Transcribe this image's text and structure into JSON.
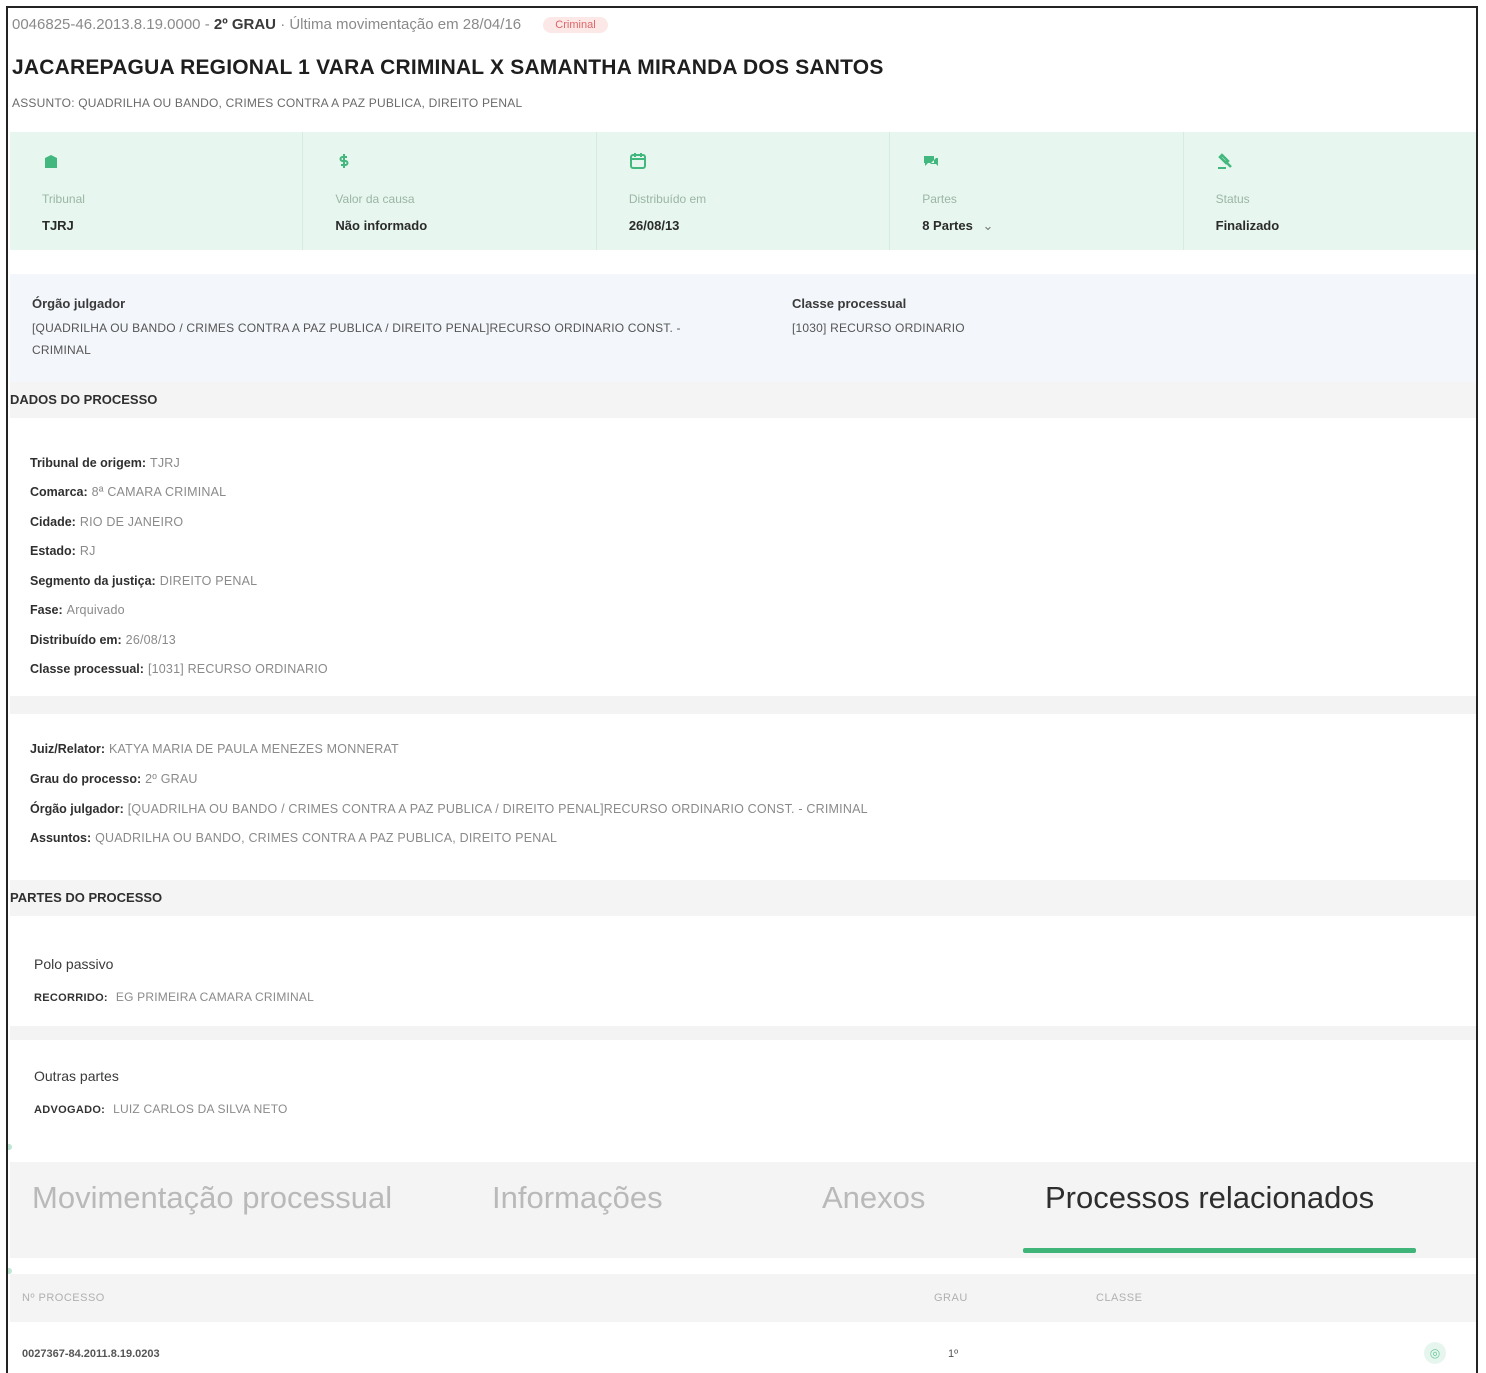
{
  "header": {
    "process_number": "0046825-46.2013.8.19.0000",
    "grau": "2º GRAU",
    "last_movement": "· Última movimentação em 28/04/16",
    "badge": "Criminal",
    "title": "JACAREPAGUA REGIONAL 1 VARA CRIMINAL X SAMANTHA MIRANDA DOS SANTOS",
    "subject": "ASSUNTO: QUADRILHA OU BANDO, CRIMES CONTRA A PAZ PUBLICA, DIREITO PENAL"
  },
  "summary": [
    {
      "icon": "building-icon",
      "label": "Tribunal",
      "value": "TJRJ"
    },
    {
      "icon": "money-icon",
      "label": "Valor da causa",
      "value": "Não informado"
    },
    {
      "icon": "calendar-icon",
      "label": "Distribuído em",
      "value": "26/08/13"
    },
    {
      "icon": "chat-icon",
      "label": "Partes",
      "value": "8 Partes"
    },
    {
      "icon": "gavel-icon",
      "label": "Status",
      "value": "Finalizado"
    }
  ],
  "organ": {
    "orgao_label": "Órgão julgador",
    "orgao_value": "[QUADRILHA OU BANDO / CRIMES CONTRA A PAZ PUBLICA / DIREITO PENAL]RECURSO ORDINARIO CONST. - CRIMINAL",
    "classe_label": "Classe processual",
    "classe_value": "[1030] RECURSO ORDINARIO"
  },
  "dados": {
    "title": "DADOS DO PROCESSO",
    "rows": [
      {
        "label": "Tribunal de origem:",
        "value": "TJRJ"
      },
      {
        "label": "Comarca:",
        "value": "8ª CAMARA CRIMINAL"
      },
      {
        "label": "Cidade:",
        "value": "RIO DE JANEIRO"
      },
      {
        "label": "Estado:",
        "value": "RJ"
      },
      {
        "label": "Segmento da justiça:",
        "value": "DIREITO PENAL"
      },
      {
        "label": "Fase:",
        "value": "Arquivado"
      },
      {
        "label": "Distribuído em:",
        "value": "26/08/13"
      },
      {
        "label": "Classe processual:",
        "value": "[1031] RECURSO ORDINARIO"
      }
    ],
    "rows2": [
      {
        "label": "Juiz/Relator:",
        "value": "KATYA MARIA DE PAULA MENEZES MONNERAT"
      },
      {
        "label": "Grau do processo:",
        "value": "2º GRAU"
      },
      {
        "label": "Órgão julgador:",
        "value": "[QUADRILHA OU BANDO / CRIMES CONTRA A PAZ PUBLICA / DIREITO PENAL]RECURSO ORDINARIO CONST. - CRIMINAL"
      },
      {
        "label": "Assuntos:",
        "value": "QUADRILHA OU BANDO, CRIMES CONTRA A PAZ PUBLICA, DIREITO PENAL"
      }
    ]
  },
  "partes": {
    "title": "PARTES DO PROCESSO",
    "groups": [
      {
        "heading": "Polo passivo",
        "role": "RECORRIDO:",
        "name": "EG PRIMEIRA CAMARA CRIMINAL"
      },
      {
        "heading": "Outras partes",
        "role": "ADVOGADO:",
        "name": "LUIZ CARLOS DA SILVA NETO"
      }
    ]
  },
  "tabs": [
    {
      "label": "Movimentação processual",
      "active": false
    },
    {
      "label": "Informações",
      "active": false
    },
    {
      "label": "Anexos",
      "active": false
    },
    {
      "label": "Processos relacionados",
      "active": true
    }
  ],
  "related_table": {
    "columns": [
      "Nº PROCESSO",
      "GRAU",
      "CLASSE"
    ],
    "rows": [
      {
        "processo": "0027367-84.2011.8.19.0203",
        "grau": "1º",
        "classe": ""
      }
    ]
  },
  "colors": {
    "accent": "#3fb57a",
    "summary_bg": "#e7f7ef",
    "badge_bg": "#fde8e8"
  }
}
